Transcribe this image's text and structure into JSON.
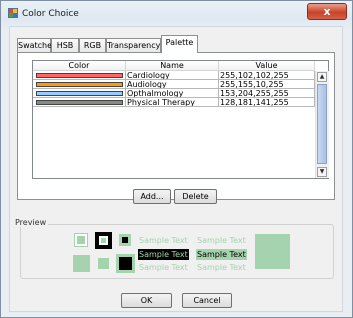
{
  "window": {
    "title": "Color Choice",
    "close_glyph": "x"
  },
  "tabs": [
    {
      "label": "Swatches",
      "active": false
    },
    {
      "label": "HSB",
      "active": false
    },
    {
      "label": "RGB",
      "active": false
    },
    {
      "label": "Transparency",
      "active": false
    },
    {
      "label": "Palette",
      "active": true
    }
  ],
  "table": {
    "columns": [
      "Color",
      "Name",
      "Value"
    ],
    "rows": [
      {
        "color": "#ff6666",
        "name": "Cardiology",
        "value": "255,102,102,255"
      },
      {
        "color": "#ff9b0a",
        "name": "Audiology",
        "value": "255,155,10,255"
      },
      {
        "color": "#99ccff",
        "name": "Opthalmology",
        "value": "153,204,255,255"
      },
      {
        "color": "#808d80",
        "name": "Physical Therapy",
        "value": "128,181,141,255"
      }
    ]
  },
  "buttons": {
    "add": "Add...",
    "delete": "Delete",
    "ok": "OK",
    "cancel": "Cancel"
  },
  "preview": {
    "label": "Preview",
    "sample_text": "Sample Text",
    "selected_color": "#a5d3ad"
  }
}
